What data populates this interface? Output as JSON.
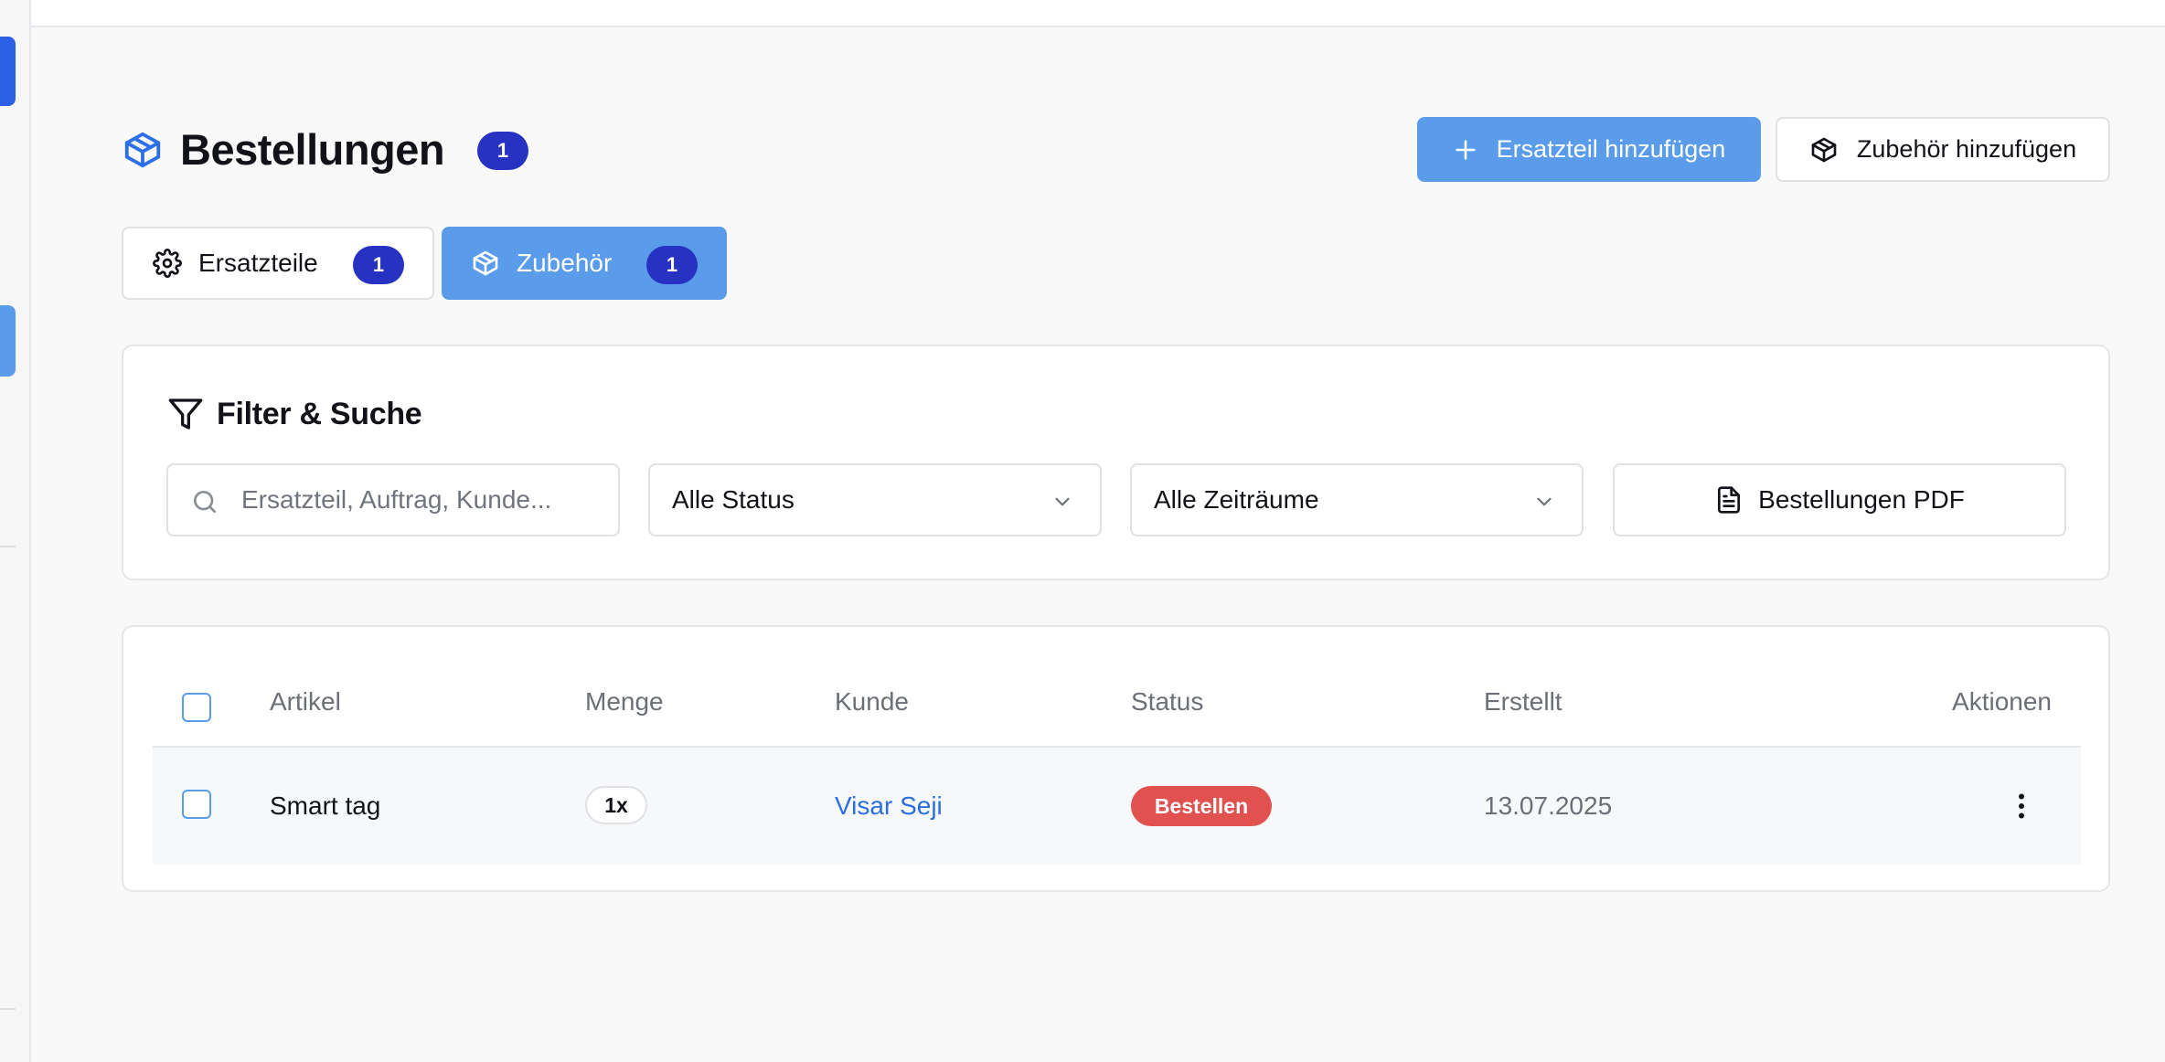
{
  "colors": {
    "primary": "#5b9cea",
    "badge": "#2832c2",
    "status_bestellen": "#e05150",
    "link": "#2b6ee0"
  },
  "header": {
    "icon": "package-icon",
    "title": "Bestellungen",
    "count": "1",
    "add_spare_label": "Ersatzteil hinzufügen",
    "add_spare_icon": "plus-icon",
    "add_accessory_label": "Zubehör hinzufügen",
    "add_accessory_icon": "package-icon"
  },
  "tabs": [
    {
      "label": "Ersatzteile",
      "count": "1",
      "icon": "gear-icon",
      "active": false
    },
    {
      "label": "Zubehör",
      "count": "1",
      "icon": "package-icon",
      "active": true
    }
  ],
  "filter": {
    "title": "Filter & Suche",
    "icon": "filter-icon",
    "search_placeholder": "Ersatzteil, Auftrag, Kunde...",
    "search_value": "",
    "status_selected": "Alle Status",
    "period_selected": "Alle Zeiträume",
    "pdf_label": "Bestellungen PDF",
    "pdf_icon": "document-icon"
  },
  "table": {
    "columns": [
      "Artikel",
      "Menge",
      "Kunde",
      "Status",
      "Erstellt",
      "Aktionen"
    ],
    "rows": [
      {
        "article": "Smart tag",
        "quantity": "1x",
        "customer": "Visar Seji",
        "status": "Bestellen",
        "created": "13.07.2025",
        "actions_icon": "more-vertical-icon"
      }
    ]
  }
}
